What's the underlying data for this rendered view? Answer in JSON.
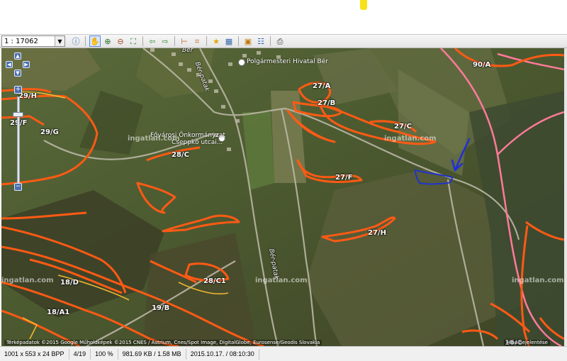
{
  "toolbar": {
    "scale_value": "1 : 17062",
    "buttons": [
      {
        "name": "info-icon",
        "glyph": "ⓘ"
      },
      {
        "name": "pan-hand-icon",
        "glyph": "✋"
      },
      {
        "name": "zoom-in-icon",
        "glyph": "🔍"
      },
      {
        "name": "zoom-out-icon",
        "glyph": "🔍"
      },
      {
        "name": "fit-extent-icon",
        "glyph": "⛶"
      },
      {
        "name": "back-arrow-icon",
        "glyph": "⇦"
      },
      {
        "name": "forward-arrow-icon",
        "glyph": "⇨"
      },
      {
        "name": "measure-icon",
        "glyph": "📐"
      },
      {
        "name": "crop-icon",
        "glyph": "⌗"
      },
      {
        "name": "bookmark-star-icon",
        "glyph": "★"
      },
      {
        "name": "image-icon",
        "glyph": "🖼"
      },
      {
        "name": "export-icon",
        "glyph": "▣"
      },
      {
        "name": "print-icon",
        "glyph": "⎙"
      },
      {
        "name": "layers-icon",
        "glyph": "☷"
      }
    ]
  },
  "map": {
    "parcel_labels": [
      "90/A",
      "27/A",
      "27/B",
      "27/C",
      "29/H",
      "29/F",
      "29/G",
      "28/C",
      "27/F",
      "27/H",
      "18/D",
      "28/C1",
      "18/A1",
      "19/B",
      "16/C"
    ],
    "place_labels": {
      "village": "Bér",
      "stream_top": "Bér-patak",
      "stream_bottom": "Bér-patak",
      "poi_1": "Polgármesteri Hivatal Bér",
      "poi_2_line1": "Fővárosi Önkormányzat",
      "poi_2_line2": "Cseppkő utcai..."
    },
    "watermark": "ingatlan.com",
    "attribution": "Térképadatok ©2015 Google Műholdképek ©2015 CNES / Astrium, Cnes/Spot Image, DigitalGlobe, Eurosense/Geodis Slovakia",
    "attribution_right": "Hiba bejelentése",
    "colors": {
      "parcel_outline": "#ff5a14",
      "highlight_parcel": "#2233cc",
      "boundary_pink": "#ff7a9a",
      "road": "#b9b6a4"
    }
  },
  "status": {
    "dimensions": "1001 x 553 x 24 BPP",
    "page": "4/19",
    "zoom": "100 %",
    "filesize": "981.69 KB / 1.58 MB",
    "datetime": "2015.10.17. / 08:10:30"
  }
}
